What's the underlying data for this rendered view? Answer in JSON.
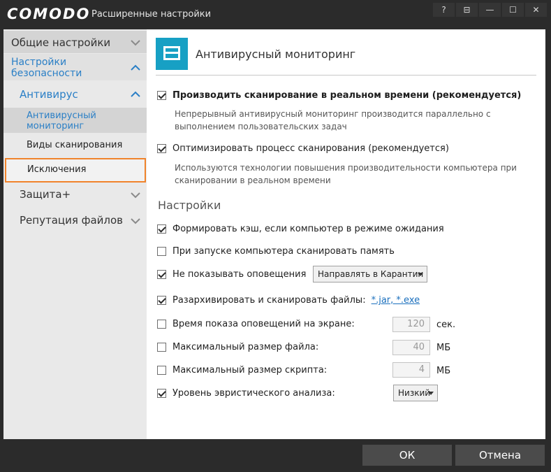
{
  "window": {
    "logo": "COMODO",
    "title": "Расширенные настройки",
    "controls": {
      "help": "?",
      "min_to_tray": "⊟",
      "minimize": "—",
      "maximize": "☐",
      "close": "✕"
    }
  },
  "sidebar": {
    "general": "Общие настройки",
    "security": "Настройки безопасности",
    "antivirus": "Антивирус",
    "av_monitoring": "Антивирусный мониторинг",
    "scan_types": "Виды сканирования",
    "exclusions": "Исключения",
    "protection": "Защита+",
    "file_reputation": "Репутация файлов"
  },
  "main": {
    "title": "Антивирусный мониторинг",
    "realtime": {
      "label": "Производить сканирование в реальном времени (рекомендуется)",
      "checked": true,
      "description": "Непрерывный антивирусный мониторинг производится параллельно с выполнением пользовательских задач"
    },
    "optimize": {
      "label": "Оптимизировать процесс сканирования (рекомендуется)",
      "checked": true,
      "description": "Используются технологии повышения производительности компьютера при сканировании в реальном времени"
    },
    "settings_title": "Настройки",
    "options": {
      "cache": {
        "label": "Формировать кэш, если компьютер в режиме ожидания",
        "checked": true
      },
      "scan_memory": {
        "label": "При запуске компьютера сканировать память",
        "checked": false
      },
      "no_alerts": {
        "label": "Не показывать оповещения",
        "checked": true,
        "dropdown": "Направлять в Карантин"
      },
      "unpack": {
        "label": "Разархивировать и сканировать файлы:",
        "checked": true,
        "link": "*.jar, *.exe"
      },
      "alert_time": {
        "label": "Время показа оповещений на экране:",
        "checked": false,
        "value": "120",
        "unit": "сек."
      },
      "max_file": {
        "label": "Максимальный размер файла:",
        "checked": false,
        "value": "40",
        "unit": "МБ"
      },
      "max_script": {
        "label": "Максимальный размер скрипта:",
        "checked": false,
        "value": "4",
        "unit": "МБ"
      },
      "heuristics": {
        "label": "Уровень эвристического анализа:",
        "checked": true,
        "dropdown": "Низкий"
      }
    }
  },
  "footer": {
    "ok": "ОК",
    "cancel": "Отмена"
  }
}
